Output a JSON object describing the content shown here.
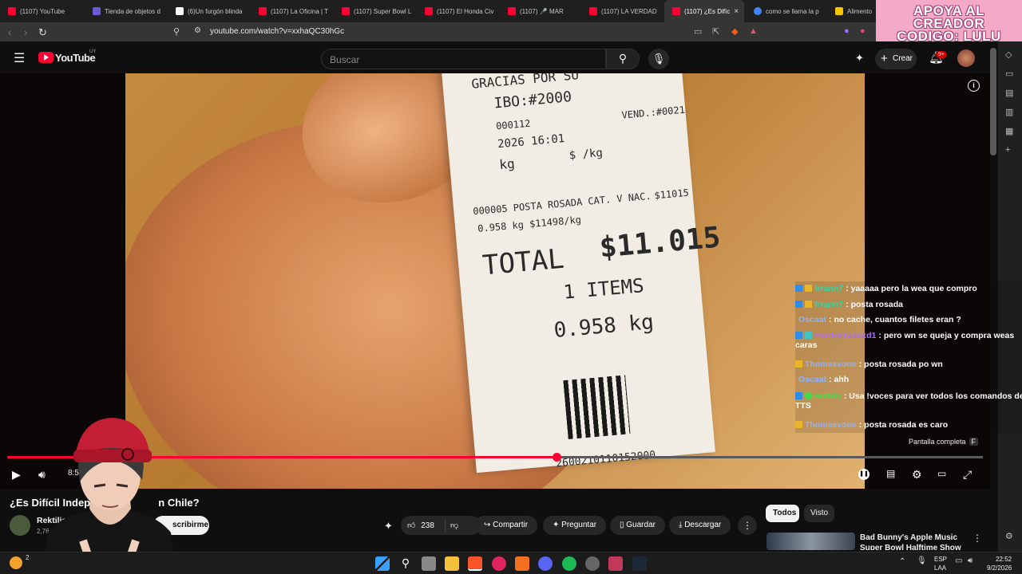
{
  "browser": {
    "tabs": [
      {
        "label": "(1107) YouTube",
        "color": "#ff0033"
      },
      {
        "label": "Tienda de objetos d",
        "color": "#6b5bd6"
      },
      {
        "label": "(6)Un furgón blinda",
        "color": "#ffffff"
      },
      {
        "label": "(1107) La Oficina | T",
        "color": "#ff0033"
      },
      {
        "label": "(1107) Super Bowl L",
        "color": "#ff0033"
      },
      {
        "label": "(1107) El Honda Civ",
        "color": "#ff0033"
      },
      {
        "label": "(1107) 🎤 MAR",
        "color": "#ff0033"
      },
      {
        "label": "(1107) LA VERDAD",
        "color": "#ff0033"
      },
      {
        "label": "(1107) ¿Es Difíc",
        "color": "#ff0033"
      },
      {
        "label": "como se llama la p",
        "color": "#4285f4"
      },
      {
        "label": "Alimento",
        "color": "#f6c400"
      }
    ],
    "close_tab": "×",
    "url": "youtube.com/watch?v=xxhaQC30hGc"
  },
  "promo": {
    "line1": "APOYA AL CREADOR",
    "line2": "CODIGO: LULU"
  },
  "youtube": {
    "logo": "YouTube",
    "region": "UY",
    "search_placeholder": "Buscar",
    "create_label": "Crear",
    "notif_count": "9+"
  },
  "receipt": {
    "header": "GRACIAS POR SU",
    "recibo": "IBO:#2000",
    "line_a": "000112",
    "line_b": "VEND.:#0021",
    "date": "2026   16:01",
    "unit": "$ /kg",
    "kg_label": "kg",
    "item": "000005  POSTA ROSADA CAT. V NAC.",
    "item_price": "$11015",
    "weight_line": "0.958 kg     $11498/kg",
    "total_label": "TOTAL",
    "total_value": "$11.015",
    "items_line": "1   ITEMS",
    "weight": "0.958 kg",
    "barcode": "2600210110152000"
  },
  "chat": [
    {
      "user": "frrann7",
      "msg": ": yaaaaa pero la wea que compro",
      "color": "#3ad3a0"
    },
    {
      "user": "frrann7",
      "msg": ": posta rosada",
      "color": "#3ad3a0"
    },
    {
      "user": "Oscaat",
      "msg": ": no cache, cuantos filetes eran ?",
      "color": "#8ab4ff"
    },
    {
      "user": "PanTostadoxd1",
      "msg": ": pero wn se queja y compra weas",
      "msg2": "caras",
      "color": "#b06bff"
    },
    {
      "user": "Thomasvone",
      "msg": ": posta rosada po wn",
      "color": "#8ab4ff"
    },
    {
      "user": "Oscaat",
      "msg": ": ahh",
      "color": "#8ab4ff"
    },
    {
      "user": "BotRix",
      "msg": ": Usa !voces para ver todos los comandos del",
      "msg2": "TTS",
      "color": "#3ee04a"
    },
    {
      "user": "Thomasvone",
      "msg": ": posta rosada es caro",
      "color": "#8ab4ff"
    }
  ],
  "player": {
    "time": "8:54 / 15",
    "progress": 0.5627,
    "fullscreen_tip": "Pantalla completa",
    "fullscreen_key": "F"
  },
  "video": {
    "title": "¿Es Difícil Indepen",
    "title_tail": "n Chile?",
    "channel": "Rektilian",
    "subs": "2,76",
    "subscribe": "scribirme",
    "likes": "238",
    "share": "Compartir",
    "ask": "Preguntar",
    "save": "Guardar",
    "download": "Descargar",
    "more": "⋮"
  },
  "recs": {
    "filters": [
      "Todos",
      "Visto"
    ],
    "first_title": "Bad Bunny's Apple Music Super Bowl Halftime Show"
  },
  "taskbar": {
    "lang1": "ESP",
    "lang2": "LAA",
    "time": "22:52",
    "date": "9/2/2026",
    "weather": "2"
  }
}
